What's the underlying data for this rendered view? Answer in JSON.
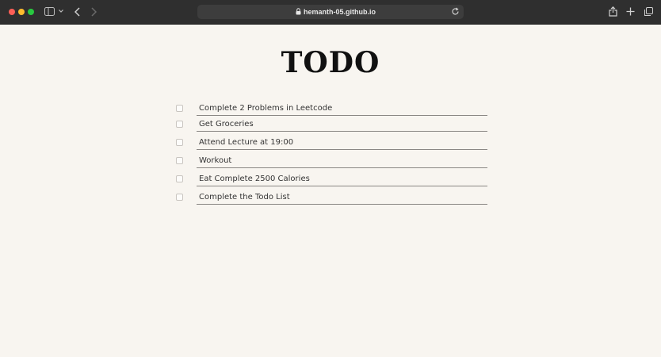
{
  "browser": {
    "url": "hemanth-05.github.io",
    "icons": [
      "sidebar-icon",
      "chevron-down-icon",
      "back-icon",
      "forward-icon",
      "lock-icon",
      "reload-icon",
      "share-icon",
      "new-tab-icon",
      "tabs-overview-icon"
    ]
  },
  "page": {
    "title": "TODO",
    "todos": [
      {
        "text": "Complete 2 Problems in Leetcode",
        "checked": false
      },
      {
        "text": "Get Groceries",
        "checked": false
      },
      {
        "text": "Attend Lecture at 19:00",
        "checked": false
      },
      {
        "text": "Workout",
        "checked": false
      },
      {
        "text": "Eat Complete 2500 Calories",
        "checked": false
      },
      {
        "text": "Complete the Todo List",
        "checked": false
      }
    ]
  }
}
